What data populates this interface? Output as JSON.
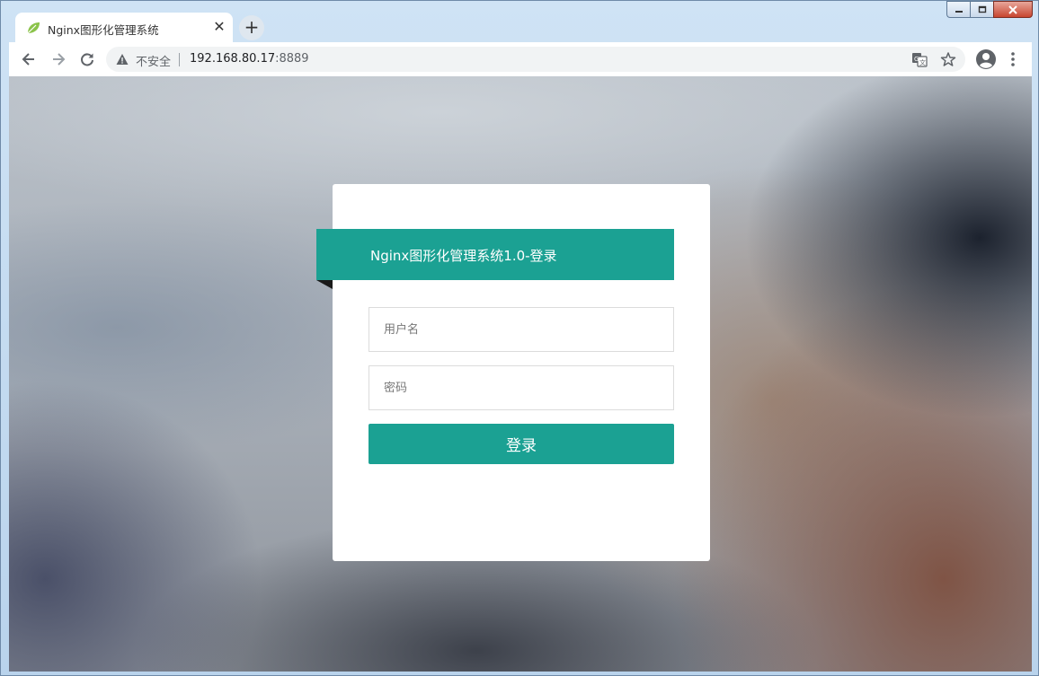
{
  "browser": {
    "tab": {
      "title": "Nginx图形化管理系统",
      "favicon": "leaf-icon",
      "close_label": "✕"
    },
    "new_tab_label": "+",
    "window_controls": [
      "minimize-icon",
      "maximize-icon",
      "close-icon"
    ],
    "address": {
      "security_label": "不安全",
      "host": "192.168.80.17",
      "port": ":8889"
    },
    "toolbar_icons": [
      "back-arrow-icon",
      "forward-arrow-icon",
      "reload-icon",
      "translate-icon",
      "bookmark-star-icon",
      "profile-icon",
      "more-vert-icon"
    ]
  },
  "login": {
    "header_title": "Nginx图形化管理系统1.0-登录",
    "username_placeholder": "用户名",
    "password_placeholder": "密码",
    "submit_label": "登录"
  },
  "colors": {
    "accent": "#1ba193",
    "card_bg": "#ffffff"
  }
}
